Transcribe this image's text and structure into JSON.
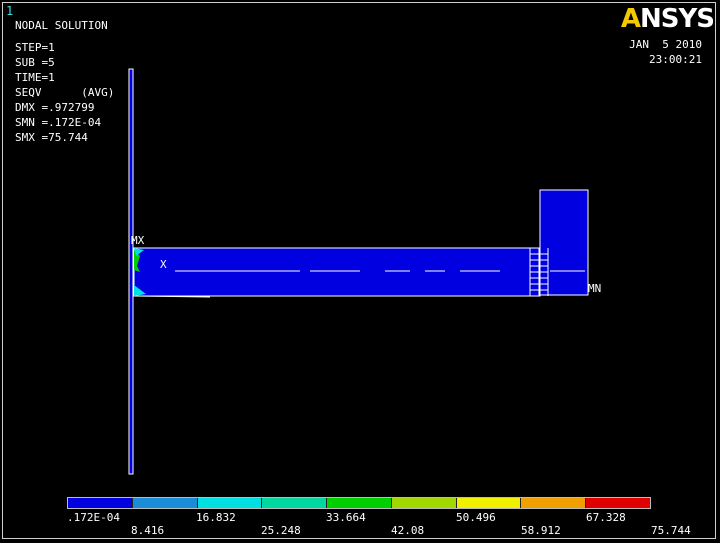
{
  "window_number": "1",
  "header": {
    "title": "NODAL SOLUTION",
    "lines": [
      "STEP=1",
      "SUB =5",
      "TIME=1",
      "SEQV      (AVG)",
      "DMX =.972799",
      "SMN =.172E-04",
      "SMX =75.744"
    ]
  },
  "logo": {
    "text_a": "A",
    "text_rest": "NSYS"
  },
  "date": {
    "day": "JAN  5 2010",
    "time": "23:00:21"
  },
  "model_labels": {
    "mx": "MX",
    "x": "X",
    "mn": "MN"
  },
  "legend": {
    "colors": [
      "#0000e0",
      "#1a8cd8",
      "#00e0e0",
      "#00d8a0",
      "#00d000",
      "#a0d800",
      "#f0f000",
      "#f0a000",
      "#e00000"
    ],
    "ticks_top": [
      ".172E-04",
      "16.832",
      "33.664",
      "50.496",
      "67.328"
    ],
    "ticks_bottom": [
      "8.416",
      "25.248",
      "42.08",
      "58.912",
      "75.744"
    ]
  }
}
